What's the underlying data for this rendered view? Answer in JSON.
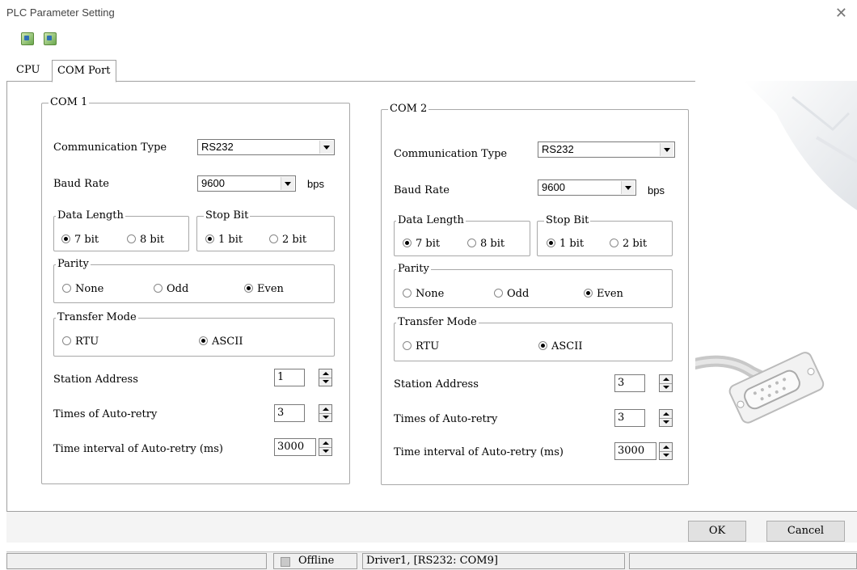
{
  "window": {
    "title": "PLC Parameter Setting"
  },
  "toolbar": {
    "icons": [
      "upload-icon",
      "download-icon"
    ]
  },
  "tabs": [
    "CPU",
    "COM Port"
  ],
  "labels": {
    "communication_type": "Communication Type",
    "baud_rate": "Baud Rate",
    "bps": "bps",
    "data_length": "Data Length",
    "stop_bit": "Stop Bit",
    "parity": "Parity",
    "transfer_mode": "Transfer Mode",
    "station_address": "Station Address",
    "times_auto_retry": "Times of Auto-retry",
    "time_interval": "Time interval of Auto-retry (ms)",
    "bit7": "7 bit",
    "bit8": "8 bit",
    "bit1": "1 bit",
    "bit2": "2 bit",
    "none": "None",
    "odd": "Odd",
    "even": "Even",
    "rtu": "RTU",
    "ascii": "ASCII"
  },
  "com1": {
    "title": "COM 1",
    "communication_type": "RS232",
    "baud_rate": "9600",
    "data_length": "7 bit",
    "stop_bit": "1 bit",
    "parity": "Even",
    "transfer_mode": "ASCII",
    "station_address": "1",
    "times_auto_retry": "3",
    "time_interval": "3000"
  },
  "com2": {
    "title": "COM 2",
    "communication_type": "RS232",
    "baud_rate": "9600",
    "data_length": "7 bit",
    "stop_bit": "1 bit",
    "parity": "Even",
    "transfer_mode": "ASCII",
    "station_address": "3",
    "times_auto_retry": "3",
    "time_interval": "3000"
  },
  "buttons": {
    "ok": "OK",
    "cancel": "Cancel"
  },
  "status": {
    "state": "Offline",
    "driver": "Driver1, [RS232: COM9]"
  }
}
